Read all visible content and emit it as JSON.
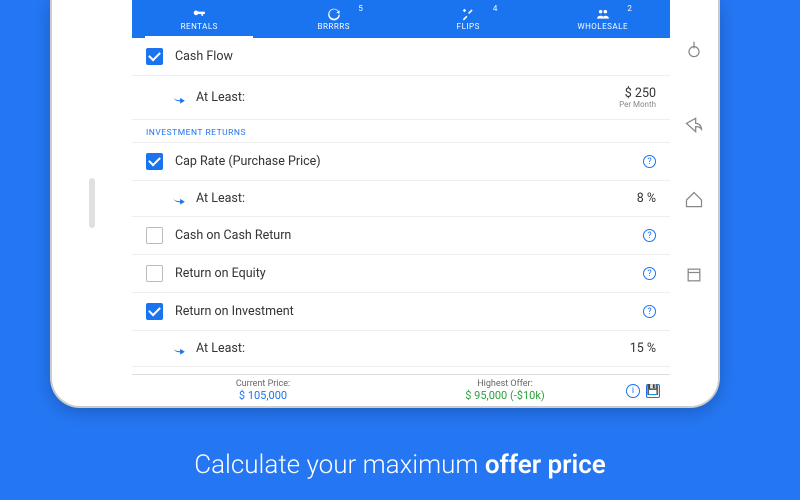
{
  "tabs": [
    {
      "label": "RENTALS",
      "badge": ""
    },
    {
      "label": "BRRRRS",
      "badge": "5"
    },
    {
      "label": "FLIPS",
      "badge": "4"
    },
    {
      "label": "WHOLESALE",
      "badge": "2"
    }
  ],
  "rows": {
    "cashflow_label": "Cash Flow",
    "at_least": "At Least:",
    "cashflow_val": "$ 250",
    "cashflow_unit": "Per Month",
    "section_returns": "INVESTMENT RETURNS",
    "caprate_label": "Cap Rate (Purchase Price)",
    "caprate_val": "8 %",
    "coc_label": "Cash on Cash Return",
    "roe_label": "Return on Equity",
    "roi_label": "Return on Investment",
    "roi_val": "15 %"
  },
  "footer": {
    "cur_label": "Current Price:",
    "cur_val": "$ 105,000",
    "high_label": "Highest Offer:",
    "high_val": "$ 95,000 (-$10k)"
  },
  "caption_pre": "Calculate your maximum ",
  "caption_bold": "offer price"
}
